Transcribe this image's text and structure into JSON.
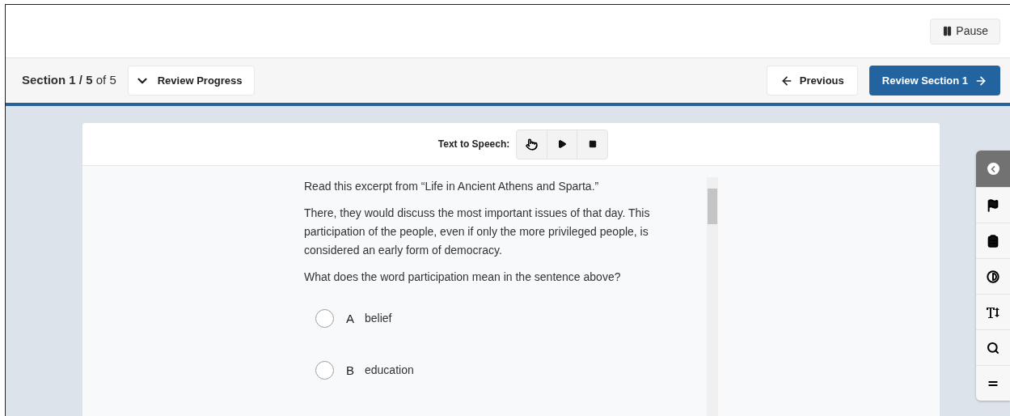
{
  "header": {
    "pause_button": "Pause"
  },
  "nav": {
    "section_label": "**Section 1 / 5** of 5",
    "review_progress_button": "Review Progress",
    "previous_button": "Previous",
    "next_button": "Review Section 1"
  },
  "text_to_speech": {
    "label": "Text to Speech:"
  },
  "question": {
    "intro": "Read this excerpt from “Life in Ancient Athens and Sparta.”",
    "excerpt": "There, they would discuss the most important issues of that day. This participation of the people, even if only the more privileged people, is considered an early form of democracy.",
    "prompt": "What does the word participation mean in the sentence above?",
    "options": [
      {
        "letter": "A",
        "text": "belief",
        "selected": false
      },
      {
        "letter": "B",
        "text": "education",
        "selected": false
      }
    ]
  }
}
